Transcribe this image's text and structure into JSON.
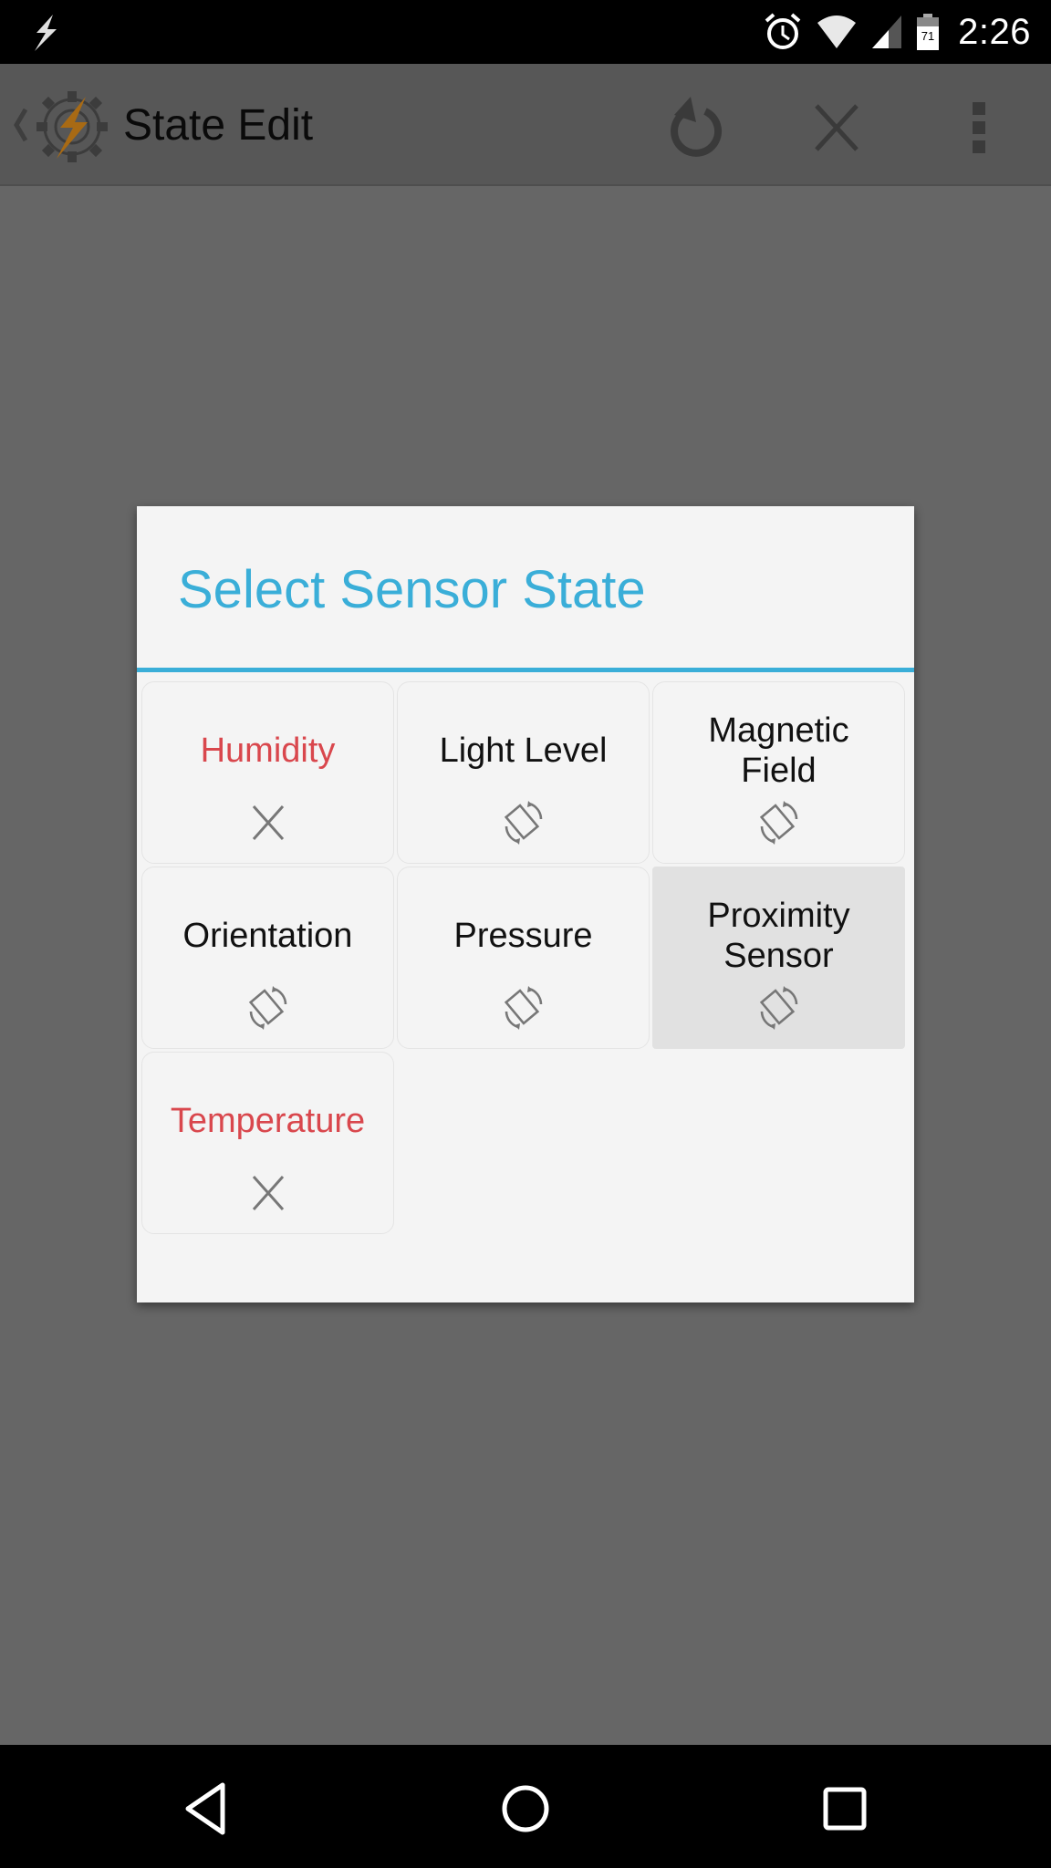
{
  "status_bar": {
    "notification_icon": "bolt-icon",
    "icons": [
      "alarm-icon",
      "wifi-icon",
      "cell-signal-icon",
      "battery-icon"
    ],
    "battery_level": "71",
    "time": "2:26"
  },
  "action_bar": {
    "title": "State Edit",
    "app_icon": "tasker-gear-bolt-icon",
    "actions": [
      {
        "name": "undo",
        "icon": "undo-icon"
      },
      {
        "name": "close",
        "icon": "close-icon"
      },
      {
        "name": "more",
        "icon": "overflow-menu-icon"
      }
    ]
  },
  "dialog": {
    "title": "Select Sensor State",
    "accent_color": "#3aaed8",
    "unavailable_color": "#d9474d",
    "items": [
      {
        "label": "Humidity",
        "available": false,
        "icon": "unavailable-x-icon",
        "selected": false
      },
      {
        "label": "Light Level",
        "available": true,
        "icon": "screen-rotation-icon",
        "selected": false
      },
      {
        "label": "Magnetic\nField",
        "available": true,
        "icon": "screen-rotation-icon",
        "selected": false
      },
      {
        "label": "Orientation",
        "available": true,
        "icon": "screen-rotation-icon",
        "selected": false
      },
      {
        "label": "Pressure",
        "available": true,
        "icon": "screen-rotation-icon",
        "selected": false
      },
      {
        "label": "Proximity\nSensor",
        "available": true,
        "icon": "screen-rotation-icon",
        "selected": true
      },
      {
        "label": "Temperature",
        "available": false,
        "icon": "unavailable-x-icon",
        "selected": false
      }
    ]
  },
  "nav_bar": {
    "buttons": [
      {
        "name": "back",
        "icon": "nav-back-icon"
      },
      {
        "name": "home",
        "icon": "nav-home-icon"
      },
      {
        "name": "recents",
        "icon": "nav-recents-icon"
      }
    ]
  }
}
